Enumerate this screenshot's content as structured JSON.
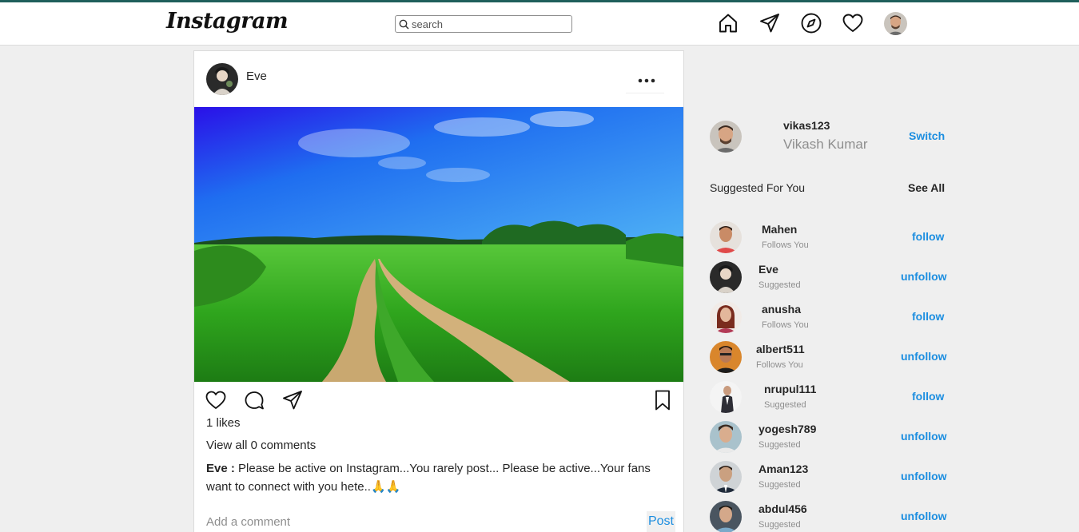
{
  "app": {
    "logo_text": "Instagram",
    "colors": {
      "accent": "#1c8ee0",
      "topline": "#1f5f5b",
      "muted": "#8e8e8e"
    }
  },
  "search": {
    "placeholder": "search"
  },
  "nav_icons": [
    "home-icon",
    "send-icon",
    "explore-icon",
    "heart-icon",
    "avatar"
  ],
  "post": {
    "username": "Eve",
    "likes": "1 likes",
    "view_comments": "View all 0 comments",
    "caption_user": "Eve :",
    "caption_text": " Please be active on Instagram...You rarely post... Please be active...Your fans want to connect with you hete..🙏🙏",
    "comment_placeholder": "Add a comment",
    "post_label": "Post"
  },
  "sidebar": {
    "username": "vikas123",
    "fullname": "Vikash Kumar",
    "switch_label": "Switch",
    "suggested_title": "Suggested For You",
    "see_all_label": "See All",
    "suggestions": [
      {
        "name": "Mahen",
        "sub": "Follows You",
        "action": "follow"
      },
      {
        "name": "Eve",
        "sub": "Suggested",
        "action": "unfollow"
      },
      {
        "name": "anusha",
        "sub": "Follows You",
        "action": "follow"
      },
      {
        "name": "albert511",
        "sub": "Follows You",
        "action": "unfollow"
      },
      {
        "name": "nrupul111",
        "sub": "Suggested",
        "action": "follow"
      },
      {
        "name": "yogesh789",
        "sub": "Suggested",
        "action": "unfollow"
      },
      {
        "name": "Aman123",
        "sub": "Suggested",
        "action": "unfollow"
      },
      {
        "name": "abdul456",
        "sub": "Suggested",
        "action": "unfollow"
      }
    ]
  }
}
